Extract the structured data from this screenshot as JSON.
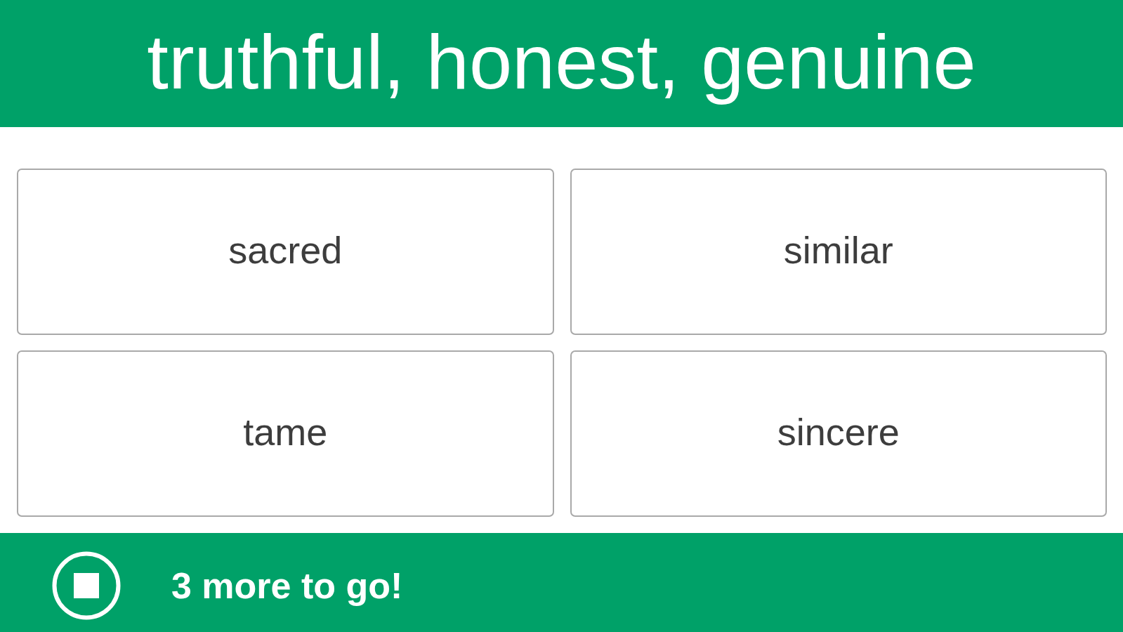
{
  "prompt": {
    "text": "truthful, honest, genuine"
  },
  "choices": [
    "sacred",
    "similar",
    "tame",
    "sincere"
  ],
  "footer": {
    "progress_text": "3 more to go!"
  }
}
